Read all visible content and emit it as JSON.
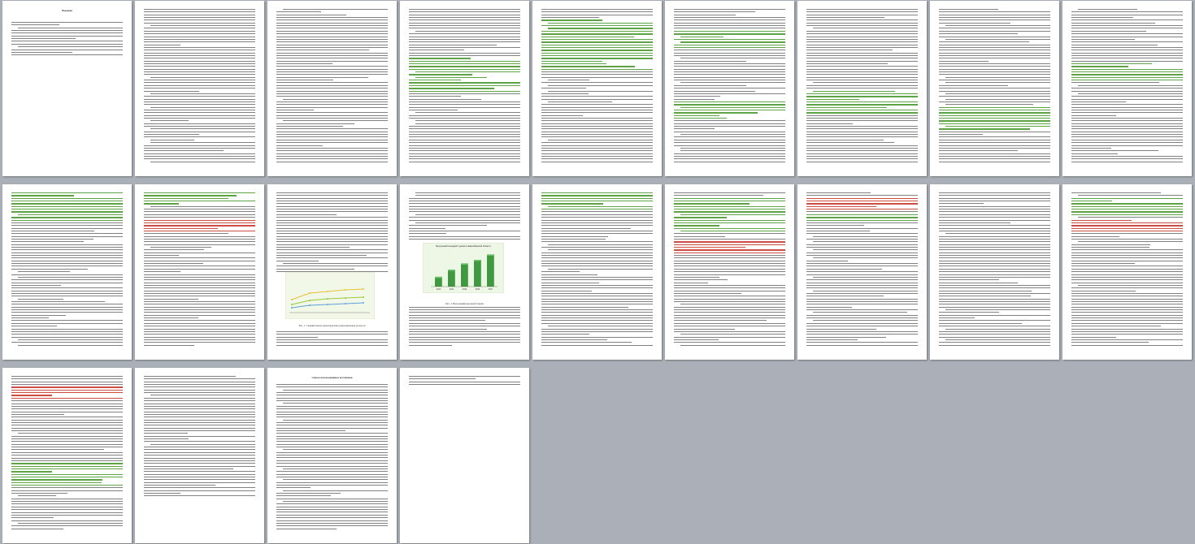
{
  "viewer": {
    "background": "#abb0b8",
    "page_count": 22
  },
  "pages": [
    {
      "id": 1,
      "heading": "Введение"
    },
    {
      "id": 2,
      "heading": ""
    },
    {
      "id": 3,
      "heading": ""
    },
    {
      "id": 4,
      "heading": ""
    },
    {
      "id": 5,
      "heading": ""
    },
    {
      "id": 6,
      "heading": ""
    },
    {
      "id": 7,
      "heading": ""
    },
    {
      "id": 8,
      "heading": ""
    },
    {
      "id": 9,
      "heading": ""
    },
    {
      "id": 10,
      "heading": ""
    },
    {
      "id": 11,
      "heading": ""
    },
    {
      "id": 12,
      "heading": ""
    },
    {
      "id": 13,
      "heading": ""
    },
    {
      "id": 14,
      "heading": ""
    },
    {
      "id": 15,
      "heading": ""
    },
    {
      "id": 16,
      "heading": ""
    },
    {
      "id": 17,
      "heading": ""
    },
    {
      "id": 18,
      "heading": ""
    },
    {
      "id": 19,
      "heading": ""
    },
    {
      "id": 20,
      "heading": ""
    },
    {
      "id": 21,
      "heading": "Список использованных источников"
    },
    {
      "id": 22,
      "heading": ""
    }
  ],
  "figures": {
    "page12_caption": "Рис. 1. Сравнительная характеристика рекреационных ресурсов",
    "page13_caption": "Рис. 2. Внутренний въездной туризм",
    "page13_chart": {
      "type": "bar",
      "title": "Внутренний въездной туризм в Новосибирской области",
      "categories": [
        "2013",
        "2014",
        "2015",
        "2016",
        "2017"
      ],
      "values": [
        22,
        38,
        52,
        60,
        72
      ],
      "ylim": [
        0,
        80
      ]
    }
  },
  "colors": {
    "text_line": "#5e5e5e",
    "highlight_green": "#4d9a33",
    "highlight_red": "#c73a2c",
    "figure_bg": "#eef6e6"
  }
}
